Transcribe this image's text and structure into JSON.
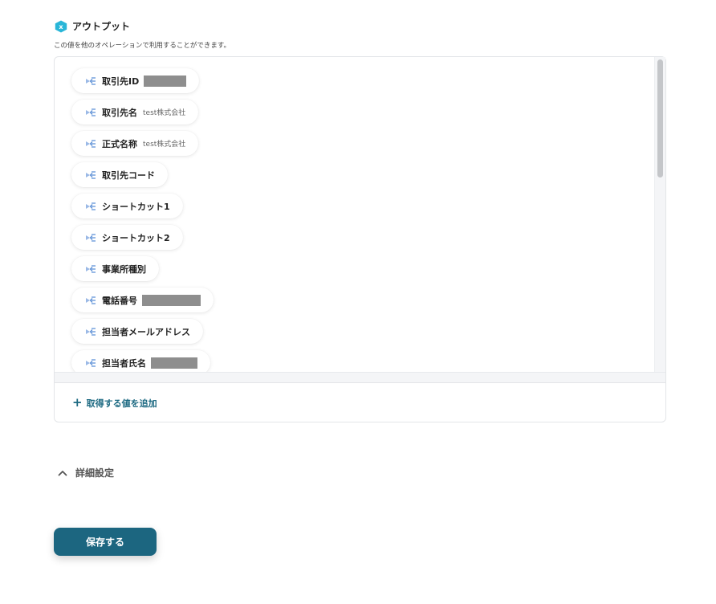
{
  "output_section": {
    "title": "アウトプット",
    "description": "この値を他のオペレーションで利用することができます。",
    "items": [
      {
        "label": "取引先ID",
        "value": "",
        "redacted": true
      },
      {
        "label": "取引先名",
        "value": "test株式会社",
        "redacted": false
      },
      {
        "label": "正式名称",
        "value": "test株式会社",
        "redacted": false
      },
      {
        "label": "取引先コード",
        "value": "",
        "redacted": false
      },
      {
        "label": "ショートカット1",
        "value": "",
        "redacted": false
      },
      {
        "label": "ショートカット2",
        "value": "",
        "redacted": false
      },
      {
        "label": "事業所種別",
        "value": "",
        "redacted": false
      },
      {
        "label": "電話番号",
        "value": "",
        "redacted": true
      },
      {
        "label": "担当者メールアドレス",
        "value": "",
        "redacted": false
      },
      {
        "label": "担当者氏名",
        "value": "",
        "redacted": true
      }
    ],
    "add_value_label": "取得する値を追加"
  },
  "advanced_settings": {
    "label": "詳細設定"
  },
  "actions": {
    "save_label": "保存する"
  },
  "colors": {
    "accent": "#1c6680",
    "link": "#1d6a82",
    "badge": "#29b6d8",
    "chip_icon": "#5b8fd6"
  },
  "icons": {
    "section_badge": "yoom-output-badge-icon",
    "chip": "variable-arrow-icon",
    "add": "plus-icon",
    "advanced_toggle": "chevron-up-icon"
  }
}
